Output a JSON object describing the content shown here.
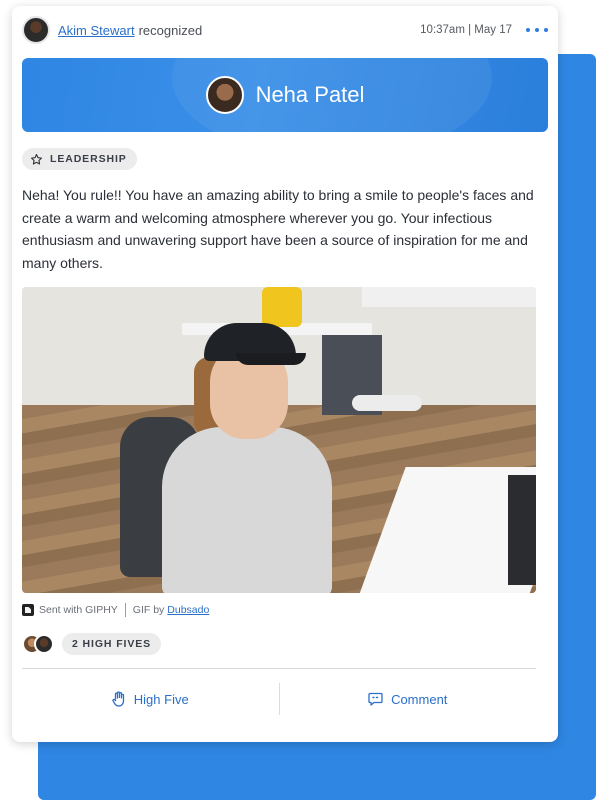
{
  "post": {
    "giver_name": "Akim Stewart",
    "action_text": "recognized",
    "timestamp": "10:37am | May 17",
    "more_icon": "more-horizontal-icon"
  },
  "recipient": {
    "name": "Neha Patel"
  },
  "badge": {
    "icon": "star-icon",
    "label": "LEADERSHIP"
  },
  "message": "Neha! You rule!! You have an amazing ability to bring a smile to people's faces and create a warm and welcoming atmosphere wherever you go. Your infectious enthusiasm and unwavering support have been a source of inspiration for me and many others.",
  "giphy": {
    "sent_with": "Sent with GIPHY",
    "gif_by": "GIF by",
    "author": "Dubsado"
  },
  "high_fives": {
    "label": "2 HIGH FIVES"
  },
  "actions": {
    "high_five": "High Five",
    "comment": "Comment"
  },
  "colors": {
    "accent_blue": "#2f86e3",
    "link_blue": "#2a6fc9"
  }
}
